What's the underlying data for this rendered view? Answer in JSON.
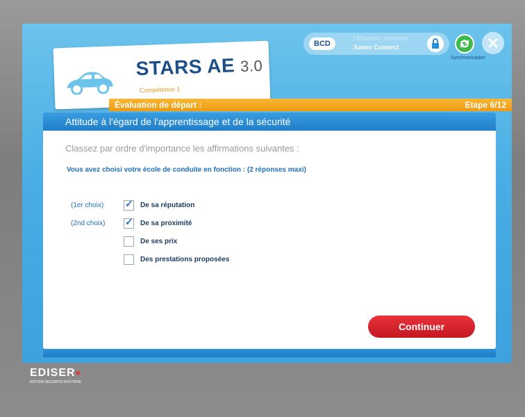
{
  "app": {
    "name": "STARS AE",
    "version": "3.0",
    "subtitle": "Compétence 1"
  },
  "user": {
    "badge": "BCD",
    "line1": "Utilisateur connecté",
    "name": "Xavier Connect"
  },
  "sync_label": "Synchronisation",
  "stage": {
    "title": "Évaluation de départ :",
    "step": "Etape 6/12"
  },
  "panel": {
    "heading": "Attitude à l'égard de l'apprentissage et de la sécurité",
    "instruction": "Classez par ordre d'importance les affirmations suivantes :",
    "question": "Vous avez choisi votre école de conduite en fonction : (2 réponses maxi)"
  },
  "options": [
    {
      "rank": "(1er choix)",
      "label": "De sa réputation",
      "checked": true
    },
    {
      "rank": "(2nd choix)",
      "label": "De sa proximité",
      "checked": true
    },
    {
      "rank": "",
      "label": "De ses prix",
      "checked": false
    },
    {
      "rank": "",
      "label": "Des prestations proposées",
      "checked": false
    }
  ],
  "continue_label": "Continuer",
  "brand": {
    "name": "EDISER",
    "tagline": "ÉDITION SÉCURITÉ ROUTIÈRE"
  },
  "colors": {
    "screen_blue": "#4aaee4",
    "stage_orange": "#f5a623",
    "accent_red": "#d9232d",
    "heading_blue": "#1f7fc9"
  }
}
